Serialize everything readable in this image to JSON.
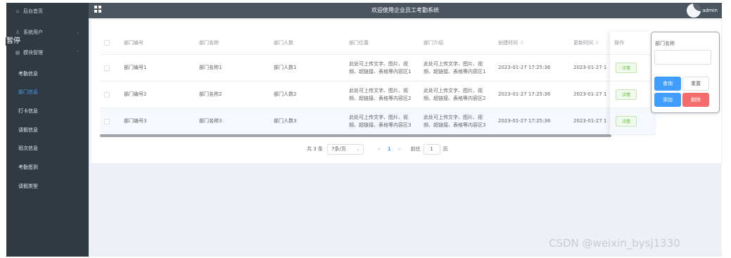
{
  "topbar": {
    "title": "欢迎使用企业员工考勤系统",
    "username": "admin"
  },
  "sidebar": {
    "home": "后台首页",
    "system_users": "系统用户",
    "module_mgmt": "模块管理",
    "paused_overlay": "暂停",
    "items": [
      "考勤信息",
      "部门信息",
      "打卡信息",
      "请假信息",
      "班次信息",
      "考勤签到",
      "请假类型"
    ],
    "active_index": 1
  },
  "table": {
    "headers": [
      "部门编号",
      "部门名称",
      "部门人数",
      "部门位置",
      "部门介绍",
      "创建时间",
      "更新时间",
      "操作"
    ],
    "rows": [
      {
        "code": "部门编号1",
        "name": "部门名称1",
        "count": "部门人数1",
        "location_1": "此处可上传文字、图片、视",
        "location_2": "频、超链接、表格等内容区1",
        "intro_1": "此处可上传文字、图片、视",
        "intro_2": "频、超链接、表格等内容区1",
        "created": "2023-01-27 17:25:36",
        "updated": "2023-01-27 1",
        "action": "详情"
      },
      {
        "code": "部门编号2",
        "name": "部门名称2",
        "count": "部门人数2",
        "location_1": "此处可上传文字、图片、视",
        "location_2": "频、超链接、表格等内容区2",
        "intro_1": "此处可上传文字、图片、视",
        "intro_2": "频、超链接、表格等内容区2",
        "created": "2023-01-27 17:25:36",
        "updated": "2023-01-27 1",
        "action": "详情"
      },
      {
        "code": "部门编号3",
        "name": "部门名称3",
        "count": "部门人数3",
        "location_1": "此处可上传文字、图片、视",
        "location_2": "频、超链接、表格等内容区3",
        "intro_1": "此处可上传文字、图片、视",
        "intro_2": "频、超链接、表格等内容区3",
        "created": "2023-01-27 17:25:36",
        "updated": "2023-01-27 1",
        "action": "详情"
      }
    ]
  },
  "pager": {
    "total": "共 3 条",
    "page_size": "7条/页",
    "prev": "<",
    "current": "1",
    "next": ">",
    "goto_label": "前往",
    "goto_value": "1",
    "page_unit": "页"
  },
  "search": {
    "label": "部门名称",
    "input_value": "",
    "query": "查询",
    "reset": "重置",
    "add": "添加",
    "delete": "删除"
  },
  "watermark": "CSDN @weixin_bysj1330"
}
